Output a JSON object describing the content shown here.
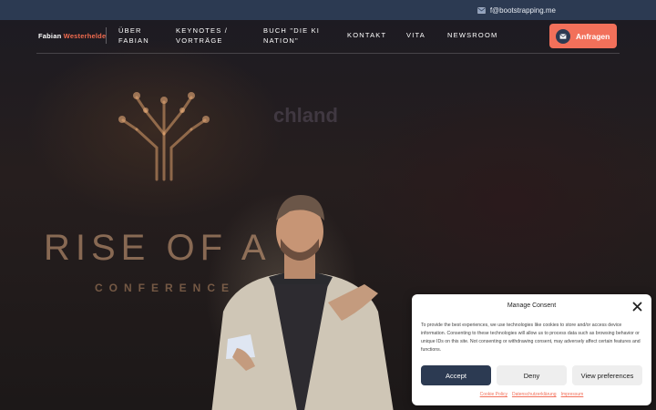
{
  "topbar": {
    "email": "f@bootstrapping.me",
    "icon": "envelope-icon"
  },
  "header": {
    "logo_first": "Fabian",
    "logo_second": "Westerhelde",
    "nav": [
      {
        "label": "ÜBER\nFABIAN"
      },
      {
        "label": "KEYNOTES /\nVORTRÄGE"
      },
      {
        "label": "BUCH \"DIE KI\nNATION\""
      },
      {
        "label": "KONTAKT"
      },
      {
        "label": "VITA"
      },
      {
        "label": "NEWSROOM"
      }
    ],
    "cta_label": "Anfragen"
  },
  "hero": {
    "stage_main": "RISE OF A",
    "stage_sub": "CONFERENCE",
    "stage_faint": "chland"
  },
  "consent": {
    "title": "Manage Consent",
    "body": "To provide the best experiences, we use technologies like cookies to store and/or access device information. Consenting to these technologies will allow us to process data such as browsing behavior or unique IDs on this site. Not consenting or withdrawing consent, may adversely affect certain features and functions.",
    "accept": "Accept",
    "deny": "Deny",
    "preferences": "View preferences",
    "links": [
      "Cookie Policy",
      "Datenschutzerklärung",
      "Impressum"
    ]
  },
  "colors": {
    "accent": "#f2705a",
    "navy": "#2c3a52"
  }
}
